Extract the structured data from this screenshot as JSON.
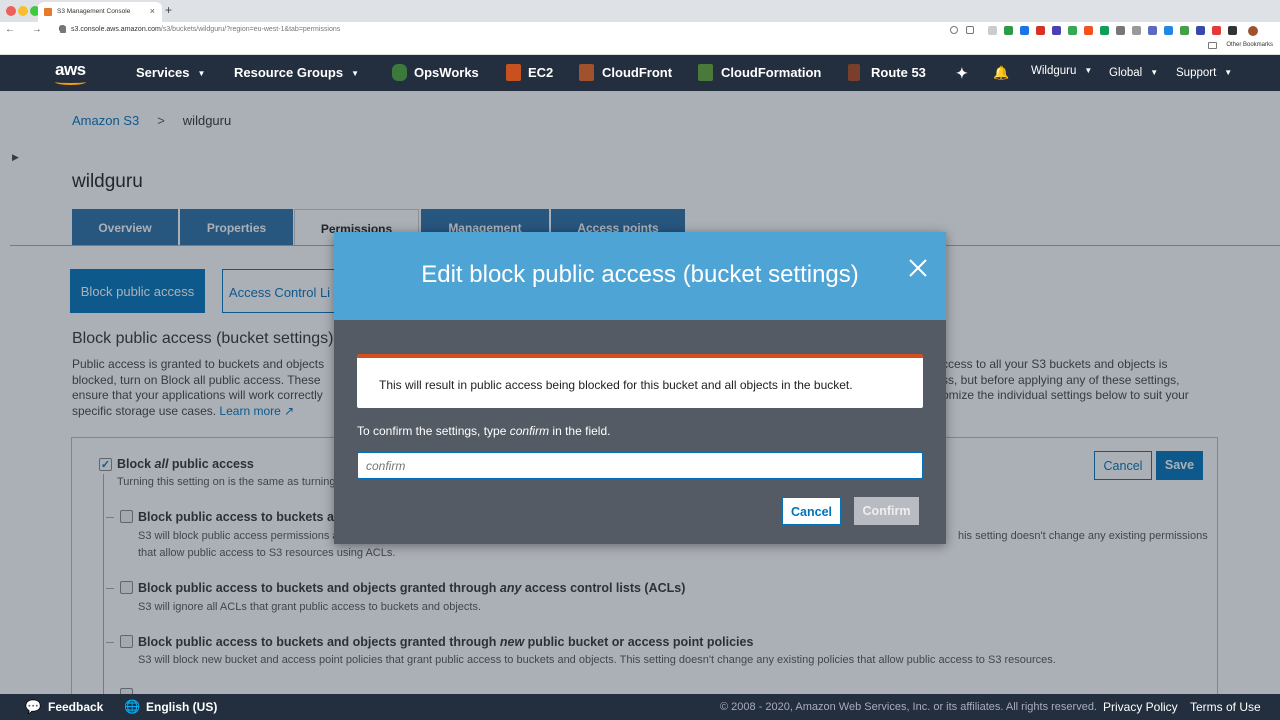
{
  "browser": {
    "tab_title": "S3 Management Console",
    "tab_close": "×",
    "new_tab": "+",
    "url_host": "s3.console.aws.amazon.com",
    "url_path": "/s3/buckets/wildguru/?region=eu-west-1&tab=permissions",
    "nav_glyphs": "← → C",
    "other_bookmarks": "Other Bookmarks"
  },
  "aws_nav": {
    "logo": "aws",
    "services": "Services",
    "resource_groups": "Resource Groups",
    "opsworks": "OpsWorks",
    "ec2": "EC2",
    "cloudfront": "CloudFront",
    "cloudformation": "CloudFormation",
    "route53": "Route 53",
    "pin_glyph": "✦",
    "bell_glyph": "🔔",
    "account": "Wildguru",
    "region": "Global",
    "support": "Support"
  },
  "breadcrumb": {
    "root": "Amazon S3",
    "sep": ">",
    "current": "wildguru"
  },
  "bucket_name": "wildguru",
  "tabs": [
    "Overview",
    "Properties",
    "Permissions",
    "Management",
    "Access points"
  ],
  "subtabs": {
    "block": "Block public access",
    "acl": "Access Control Li"
  },
  "section": {
    "title": "Block public access (bucket settings)",
    "left_l1": "Public access is granted to buckets and objects",
    "left_l2": "blocked, turn on Block all public access. These",
    "left_l3": "ensure that your applications will work correctly",
    "left_l4": "specific storage use cases.",
    "learn_more": "Learn more",
    "right_l1": "ccess to all your S3 buckets and objects is",
    "right_l2": "ss, but before applying any of these settings,",
    "right_l3": "omize the individual settings below to suit your"
  },
  "panel": {
    "block_all_pre": "Block ",
    "block_all_em": "all",
    "block_all_post": " public access",
    "block_all_desc": "Turning this setting on is the same as turning o",
    "cancel": "Cancel",
    "save": "Save",
    "opt1_title": "Block public access to buckets an",
    "opt1_desc1": "S3 will block public access permissions a",
    "opt1_desc1_right": "his setting doesn't change any existing permissions",
    "opt1_desc2": "that allow public access to S3 resources using ACLs.",
    "opt2_title_pre": "Block public access to buckets and objects granted through ",
    "opt2_title_em": "any",
    "opt2_title_post": " access control lists (ACLs)",
    "opt2_desc": "S3 will ignore all ACLs that grant public access to buckets and objects.",
    "opt3_title_pre": "Block public access to buckets and objects granted through ",
    "opt3_title_em": "new",
    "opt3_title_post": " public bucket or access point policies",
    "opt3_desc": "S3 will block new bucket and access point policies that grant public access to buckets and objects. This setting doesn't change any existing policies that allow public access to S3 resources."
  },
  "modal": {
    "title": "Edit block public access (bucket settings)",
    "close_glyph": "✕",
    "warning": "This will result in public access being blocked for this bucket and all objects in the bucket.",
    "instr_pre": "To confirm the settings, type ",
    "instr_em": "confirm",
    "instr_post": " in the field.",
    "input_placeholder": "confirm",
    "cancel": "Cancel",
    "confirm": "Confirm"
  },
  "footer": {
    "feedback": "Feedback",
    "language": "English (US)",
    "copyright": "© 2008 - 2020, Amazon Web Services, Inc. or its affiliates. All rights reserved.",
    "privacy": "Privacy Policy",
    "terms": "Terms of Use"
  },
  "colors": {
    "aws_nav": "#232f3e",
    "accent": "#0073bb",
    "modal_header": "#4fa4d6",
    "warning_border": "#d6501f"
  }
}
